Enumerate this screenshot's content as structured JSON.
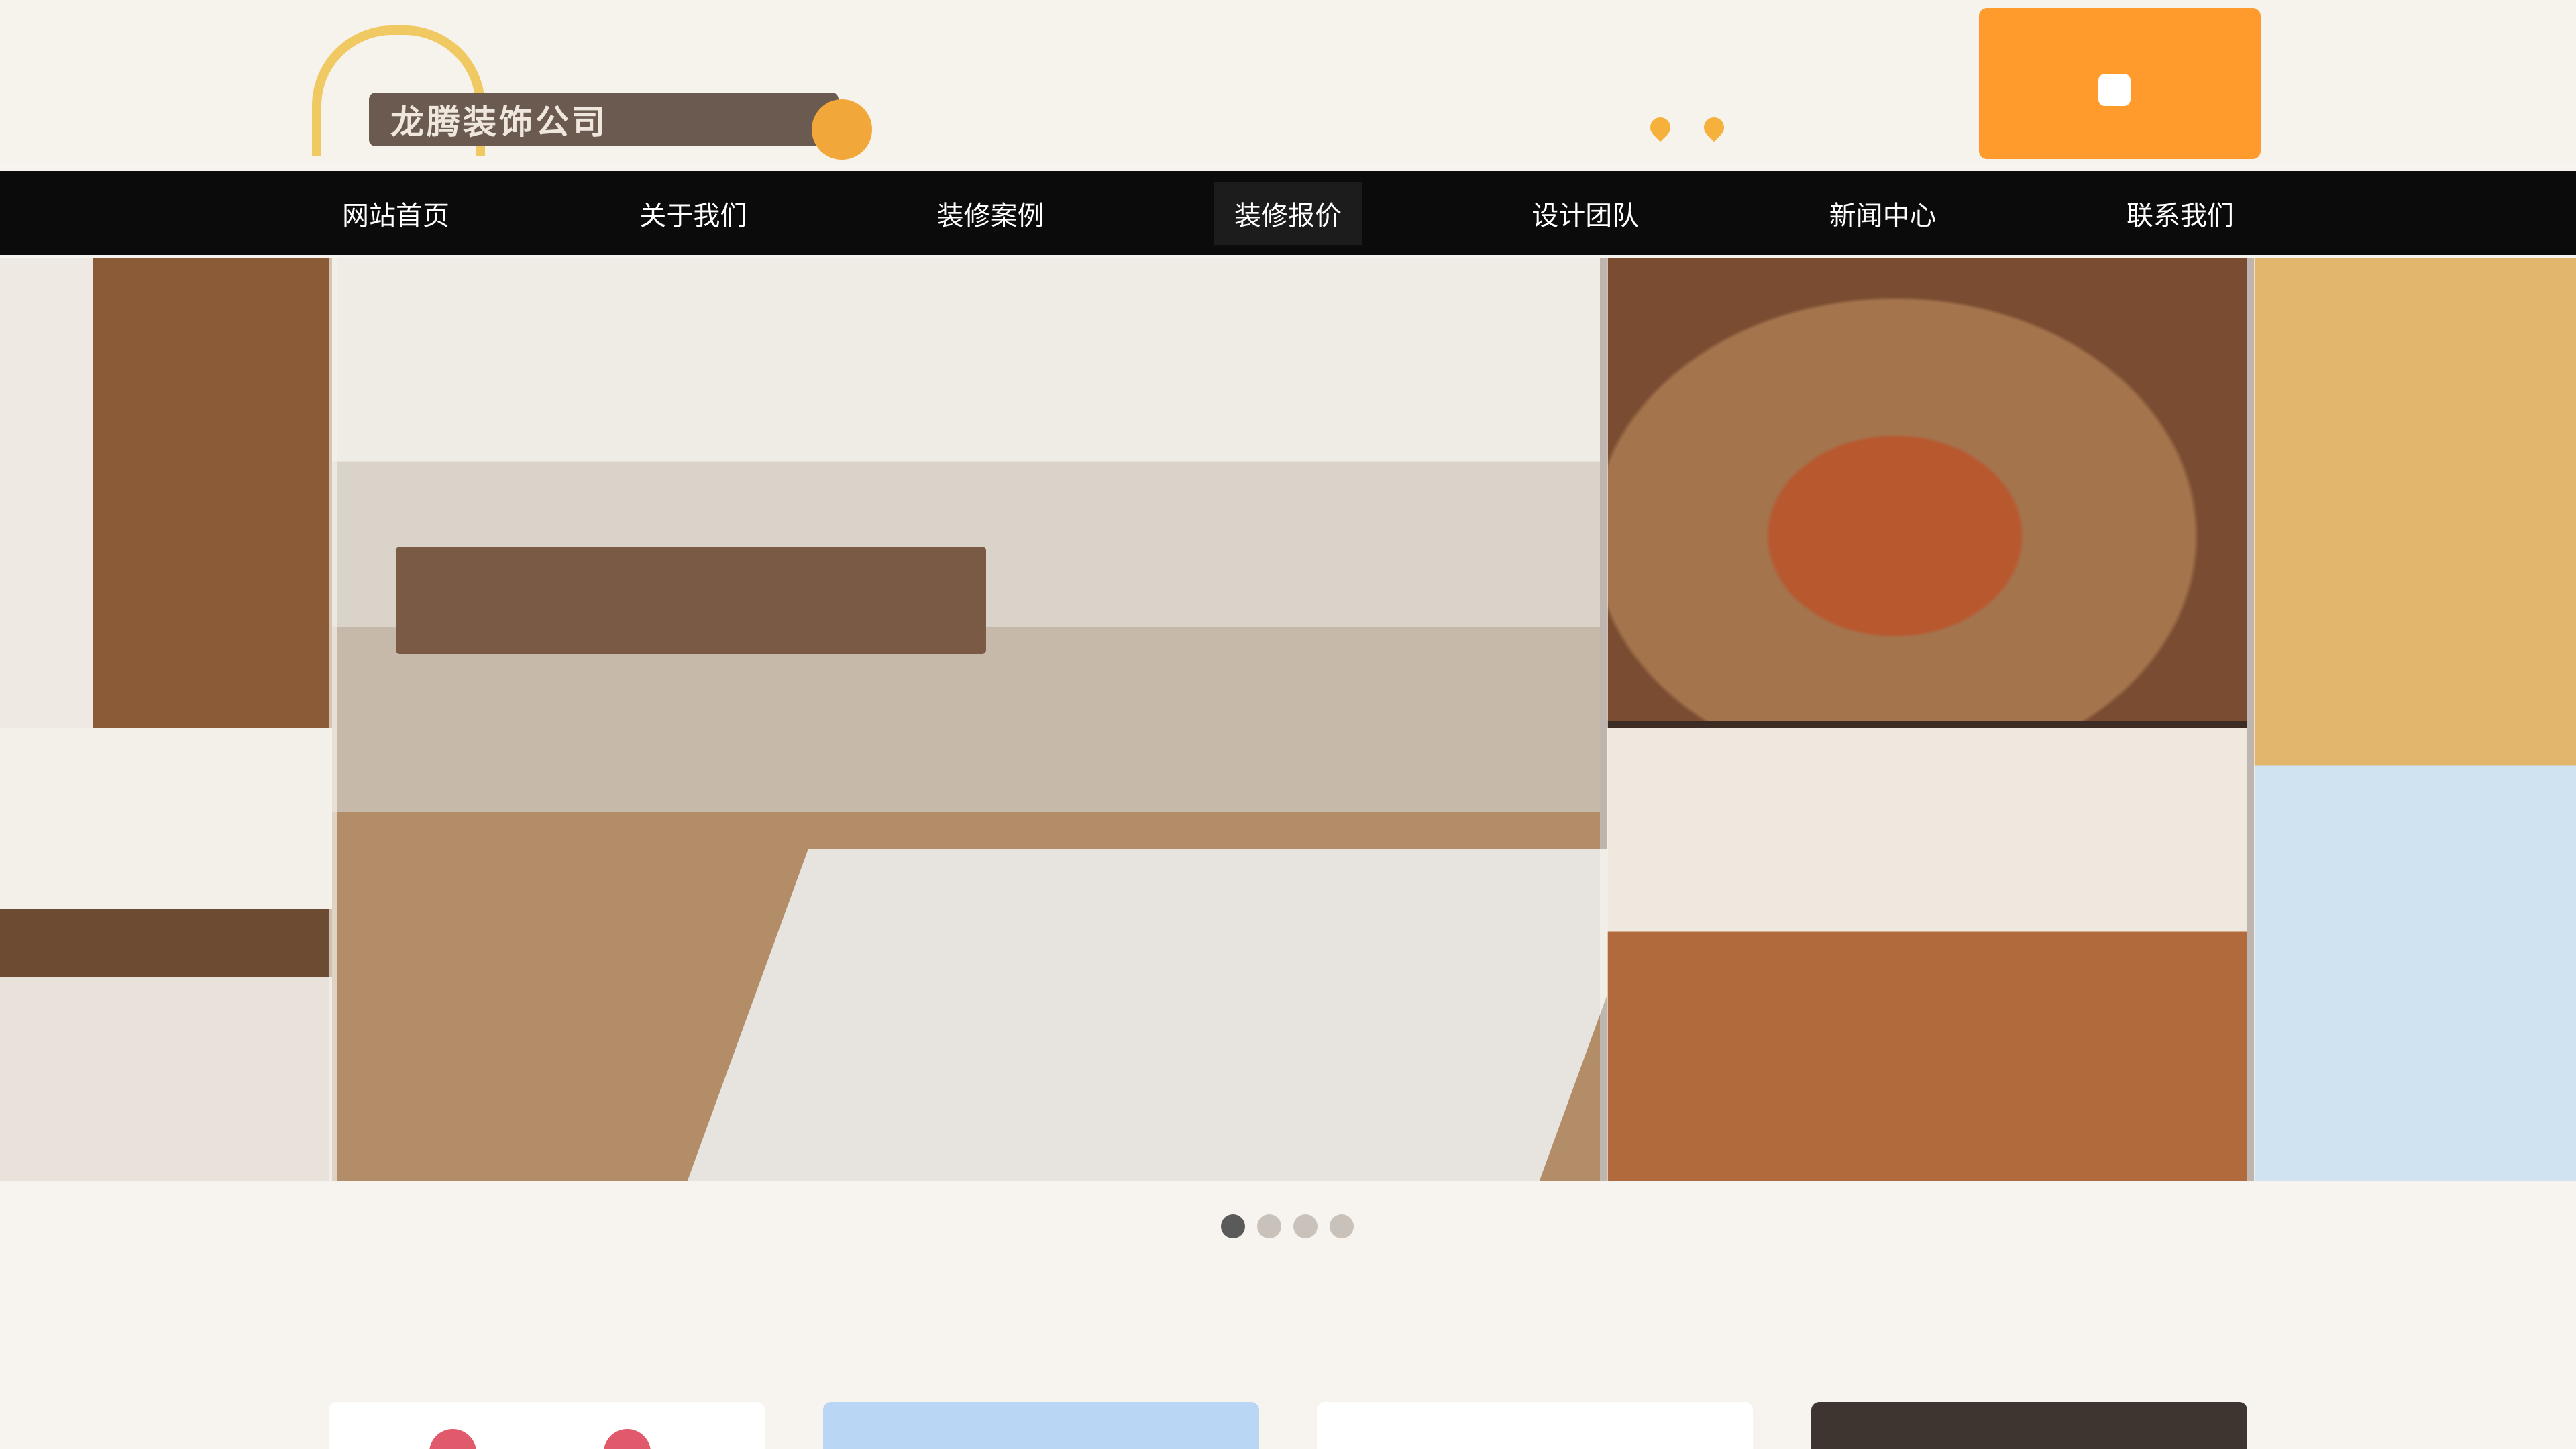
{
  "header": {
    "logo_text": "龙腾装饰公司",
    "top_links": [
      "",
      "",
      ""
    ],
    "cta_title": "",
    "cta_phone": ""
  },
  "nav": {
    "items": [
      "网站首页",
      "关于我们",
      "装修案例",
      "装修报价",
      "设计团队",
      "新闻中心",
      "联系我们"
    ],
    "active_index": 3
  },
  "hero": {
    "title": "",
    "subtitle": ""
  },
  "slider": {
    "total": 4,
    "active": 0
  },
  "section": {
    "title": ""
  },
  "colors": {
    "accent": "#ff9a2c",
    "nav_bg": "#0b0b0b",
    "page_bg": "#f7f3ee"
  }
}
